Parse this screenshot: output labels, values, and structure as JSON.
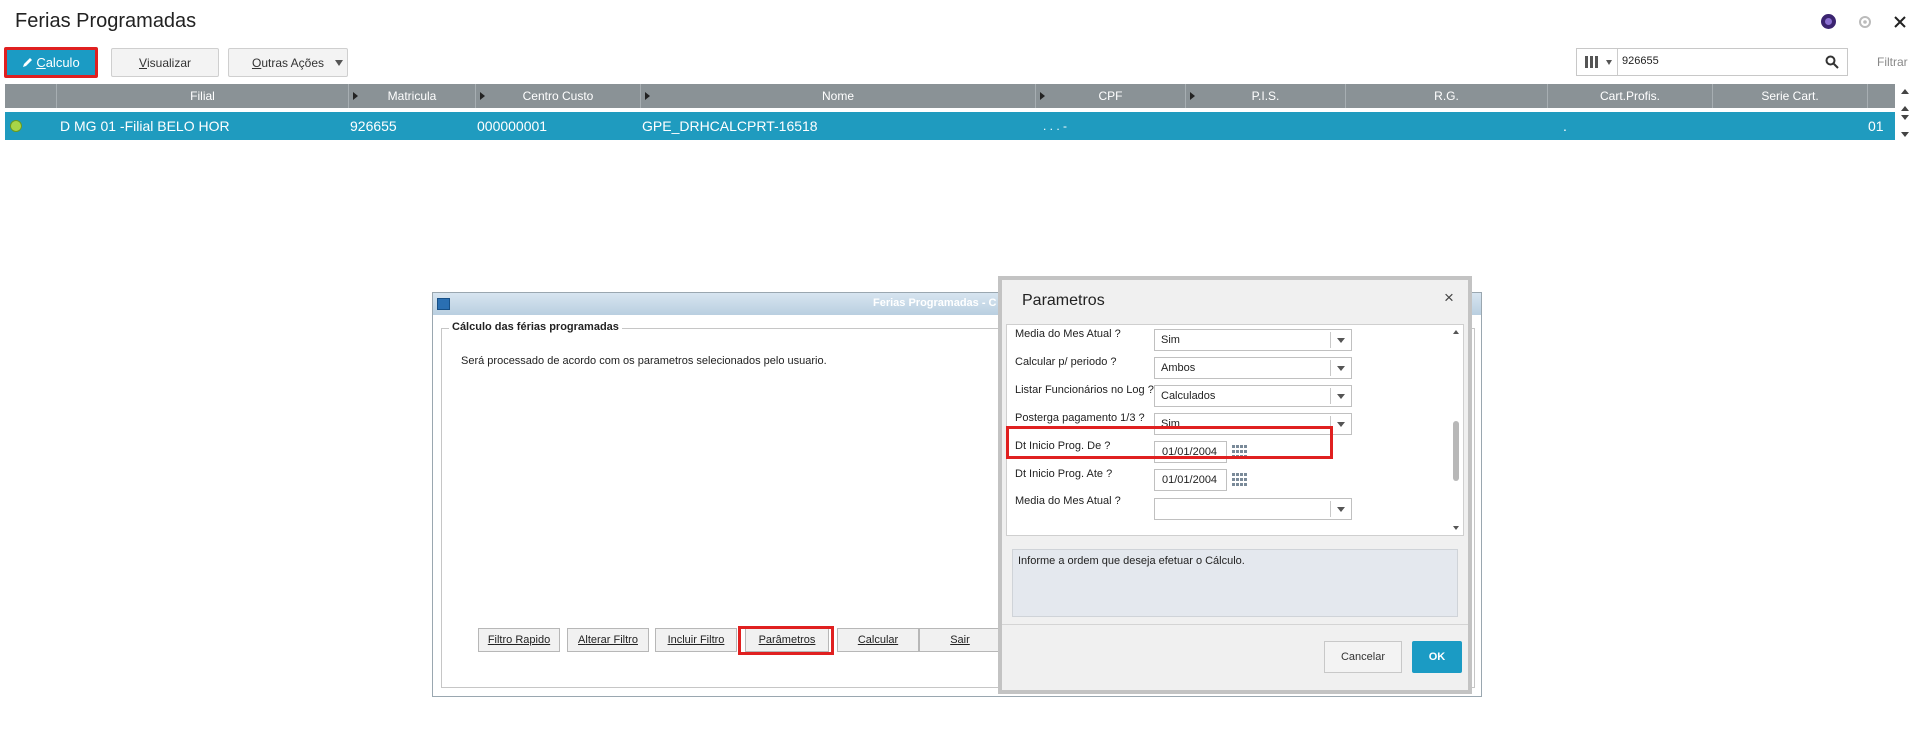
{
  "app": {
    "title": "Ferias Programadas"
  },
  "toolbar": {
    "calculo_prefix": "",
    "calculo_label": "C",
    "calculo_rest": "alculo",
    "visualizar_u": "V",
    "visualizar_rest": "isualizar",
    "outras_u": "O",
    "outras_rest": "utras Ações",
    "search_value": "926655",
    "filtrar_label": "Filtrar"
  },
  "grid": {
    "columns": [
      "Filial",
      "Matricula",
      "Centro Custo",
      "Nome",
      "CPF",
      "P.I.S.",
      "R.G.",
      "Cart.Profis.",
      "Serie Cart."
    ],
    "row": {
      "filial": "D MG 01 -Filial BELO HOR",
      "matricula": "926655",
      "centro_custo": "000000001",
      "nome": "GPE_DRHCALCPRT-16518",
      "cpf": ". . . -",
      "cart_profis": ".",
      "serie_cart": "01"
    }
  },
  "dialog_main": {
    "title": "Ferias Programadas - C",
    "group_label": "Cálculo das férias programadas",
    "description": "Será processado de acordo com os parametros selecionados pelo usuario.",
    "buttons": {
      "filtro_rapido_u": "F",
      "filtro_rapido_rest": "iltro Rapido",
      "alterar_u": "A",
      "alterar_rest": "lterar Filtro",
      "incluir_u": "I",
      "incluir_rest": "ncluir Filtro",
      "parametros_u": "P",
      "parametros_rest": "arâmetros",
      "calcular_u": "C",
      "calcular_rest": "alcular",
      "sair_u": "S",
      "sair_rest": "air"
    }
  },
  "dialog_params": {
    "title": "Parametros",
    "close": "×",
    "params": [
      {
        "label": "Media do Mes Atual ?",
        "value": "Sim"
      },
      {
        "label": "Calcular p/ periodo ?",
        "value": "Ambos"
      },
      {
        "label": "Listar Funcionários no Log ?",
        "value": "Calculados"
      },
      {
        "label": "Posterga pagamento 1/3 ?",
        "value": "Sim"
      },
      {
        "label": "Dt Inicio Prog. De ?",
        "value": "01/01/2004"
      },
      {
        "label": "Dt Inicio Prog. Ate ?",
        "value": "01/01/2004"
      },
      {
        "label": "Media do Mes Atual ?",
        "value": ""
      }
    ],
    "help_text": "Informe a ordem que deseja efetuar o  Cálculo.",
    "cancel_label": "Cancelar",
    "ok_label": "OK"
  },
  "colors": {
    "accent": "#1b9bc4",
    "highlight": "#e02020",
    "grid_header": "#8a9296",
    "selected_row": "#1f9bbf"
  }
}
